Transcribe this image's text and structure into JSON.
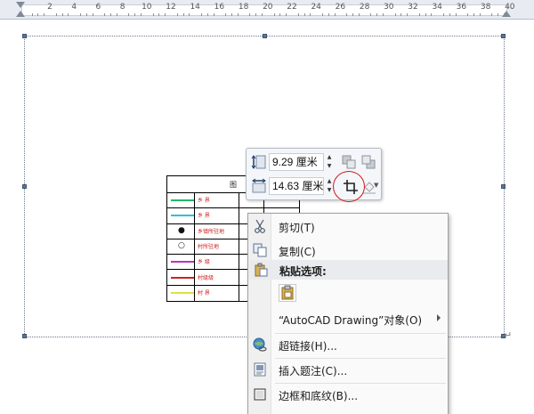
{
  "ruler": {
    "labels": [
      "2",
      "4",
      "6",
      "8",
      "10",
      "12",
      "14",
      "16",
      "18",
      "20",
      "22",
      "24",
      "26",
      "28",
      "30",
      "32",
      "34",
      "36",
      "38",
      "40"
    ]
  },
  "legend_table": {
    "header": "图",
    "rows": [
      {
        "line_color": "#1fb86a",
        "symbol": "",
        "text": "乡 界"
      },
      {
        "line_color": "#30c0e0",
        "symbol": "",
        "text": "乡 界"
      },
      {
        "line_color": "",
        "symbol": "●",
        "text": "乡镇所驻地"
      },
      {
        "line_color": "",
        "symbol": "○",
        "text": "村所驻地"
      },
      {
        "line_color": "#c030c0",
        "symbol": "",
        "text": "乡 级"
      },
      {
        "line_color": "#d02020",
        "symbol": "",
        "text": "村级级"
      },
      {
        "line_color": "#e0e040",
        "symbol": "",
        "text": "村 界"
      }
    ]
  },
  "size_toolbar": {
    "height_value": "9.29 厘米",
    "width_value": "14.63 厘米",
    "spin_up": "▲",
    "spin_down": "▼",
    "dropdown_glyph": "▼"
  },
  "context_menu": {
    "items": {
      "cut": "剪切(T)",
      "copy": "复制(C)",
      "paste_options": "粘贴选项:",
      "autocad_object": "“AutoCAD Drawing”对象(O)",
      "hyperlink": "超链接(H)...",
      "insert_caption": "插入题注(C)...",
      "borders_shading": "边框和底纹(B)..."
    }
  },
  "colors": {
    "accent_red": "#d01818",
    "frame_handle": "#5a7595"
  }
}
